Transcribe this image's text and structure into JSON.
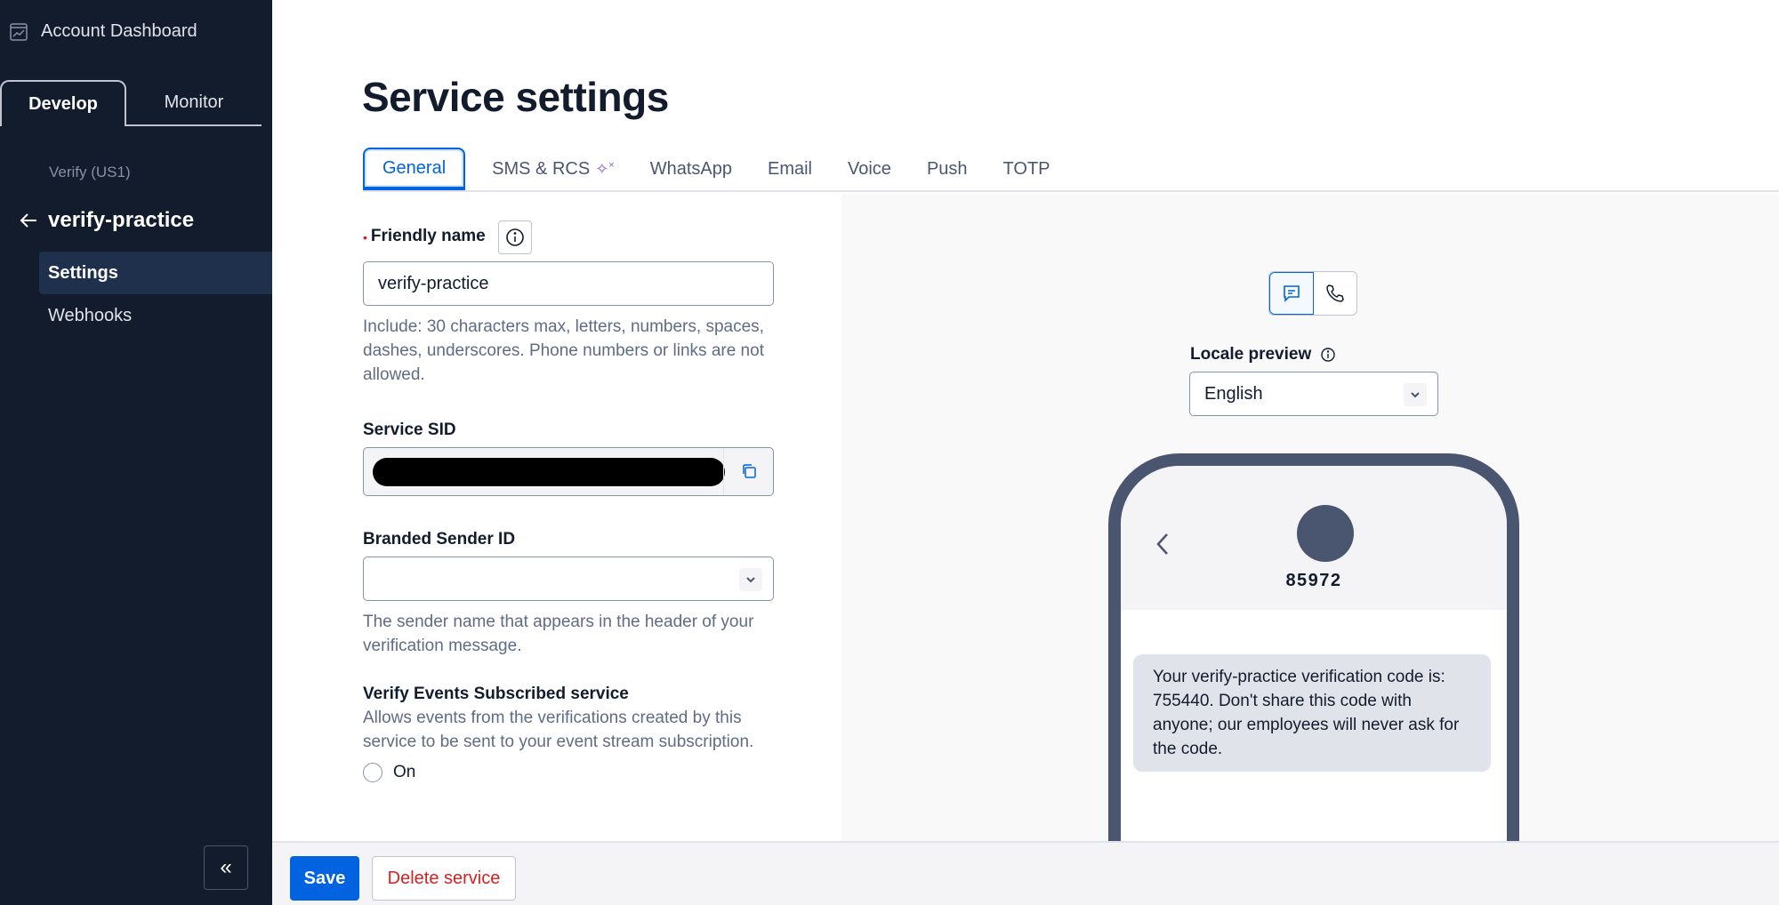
{
  "sidebar": {
    "account_label": "Account Dashboard",
    "tabs": [
      {
        "label": "Develop",
        "active": true
      },
      {
        "label": "Monitor",
        "active": false
      }
    ],
    "breadcrumb": "Verify (US1)",
    "service_name": "verify-practice",
    "items": [
      {
        "label": "Settings",
        "active": true
      },
      {
        "label": "Webhooks",
        "active": false
      }
    ],
    "collapse_label": "«"
  },
  "main": {
    "title": "Service settings",
    "tabs": [
      {
        "label": "General",
        "active": true
      },
      {
        "label": "SMS & RCS",
        "active": false,
        "badge": "sparkle-icon"
      },
      {
        "label": "WhatsApp",
        "active": false
      },
      {
        "label": "Email",
        "active": false
      },
      {
        "label": "Voice",
        "active": false
      },
      {
        "label": "Push",
        "active": false
      },
      {
        "label": "TOTP",
        "active": false
      }
    ]
  },
  "form": {
    "friendly_name": {
      "label": "Friendly name",
      "required": true,
      "value": "verify-practice",
      "help": "Include: 30 characters max, letters, numbers, spaces, dashes, underscores. Phone numbers or links are not allowed."
    },
    "service_sid": {
      "label": "Service SID",
      "value": "[redacted]"
    },
    "branded_sender": {
      "label": "Branded Sender ID",
      "value": "",
      "help": "The sender name that appears in the header of your verification message."
    },
    "verify_events": {
      "label": "Verify Events Subscribed service",
      "help": "Allows events from the verifications created by this service to be sent to your event stream subscription.",
      "option_label": "On",
      "checked": false
    }
  },
  "preview": {
    "mode": "sms",
    "locale_label": "Locale preview",
    "locale_value": "English",
    "sender_number": "85972",
    "message": "Your verify-practice verification code is: 755440. Don't share this code with anyone; our employees will never ask for the code."
  },
  "footer": {
    "save_label": "Save",
    "delete_label": "Delete service"
  },
  "colors": {
    "sidebar_bg": "#121c2d",
    "accent": "#0263e0",
    "danger": "#d61f1f",
    "phone_frame": "#4a5570"
  }
}
